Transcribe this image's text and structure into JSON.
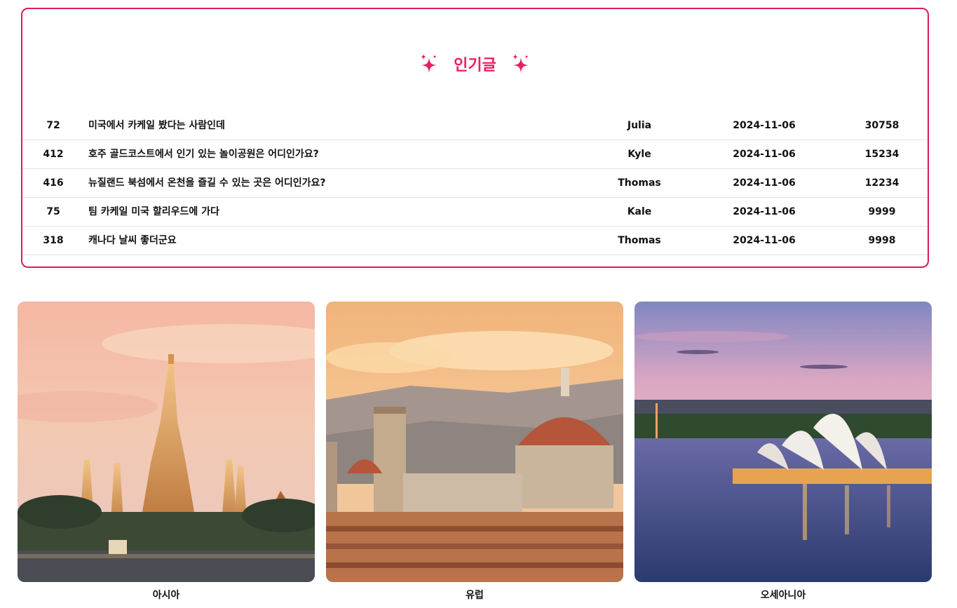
{
  "popular": {
    "title": "인기글",
    "posts": [
      {
        "id": "72",
        "title": "미국에서 카케일 봤다는 사람인데",
        "author": "Julia",
        "date": "2024-11-06",
        "views": "30758"
      },
      {
        "id": "412",
        "title": "호주 골드코스트에서 인기 있는 놀이공원은 어디인가요?",
        "author": "Kyle",
        "date": "2024-11-06",
        "views": "15234"
      },
      {
        "id": "416",
        "title": "뉴질랜드 북섬에서 온천을 즐길 수 있는 곳은 어디인가요?",
        "author": "Thomas",
        "date": "2024-11-06",
        "views": "12234"
      },
      {
        "id": "75",
        "title": "팀 카케일 미국 할리우드에 가다",
        "author": "Kale",
        "date": "2024-11-06",
        "views": "9999"
      },
      {
        "id": "318",
        "title": "캐나다 날씨 좋더군요",
        "author": "Thomas",
        "date": "2024-11-06",
        "views": "9998"
      }
    ]
  },
  "regions": [
    {
      "label": "아시아"
    },
    {
      "label": "유럽"
    },
    {
      "label": "오세아니아"
    }
  ],
  "colors": {
    "accent": "#e91e63",
    "border": "#d81b60"
  },
  "icons": {
    "title_decoration": "sparkles-icon"
  }
}
